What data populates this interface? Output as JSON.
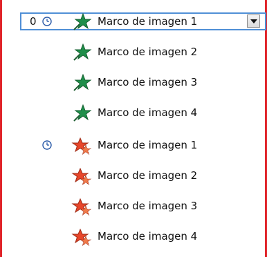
{
  "animation_pane": {
    "items": [
      {
        "order": "0",
        "has_clock": true,
        "effect": "entrance",
        "icon": "green-star-icon",
        "label": "Marco de imagen 1",
        "selected": true
      },
      {
        "order": "",
        "has_clock": false,
        "effect": "entrance",
        "icon": "green-star-icon",
        "label": "Marco de imagen 2",
        "selected": false
      },
      {
        "order": "",
        "has_clock": false,
        "effect": "entrance",
        "icon": "green-star-icon",
        "label": "Marco de imagen 3",
        "selected": false
      },
      {
        "order": "",
        "has_clock": false,
        "effect": "entrance",
        "icon": "green-star-icon",
        "label": "Marco de imagen 4",
        "selected": false
      },
      {
        "order": "",
        "has_clock": true,
        "effect": "exit",
        "icon": "red-star-icon",
        "label": "Marco de imagen 1",
        "selected": false
      },
      {
        "order": "",
        "has_clock": false,
        "effect": "exit",
        "icon": "red-star-icon",
        "label": "Marco de imagen 2",
        "selected": false
      },
      {
        "order": "",
        "has_clock": false,
        "effect": "exit",
        "icon": "red-star-icon",
        "label": "Marco de imagen 3",
        "selected": false
      },
      {
        "order": "",
        "has_clock": false,
        "effect": "exit",
        "icon": "red-star-icon",
        "label": "Marco de imagen 4",
        "selected": false
      }
    ],
    "colors": {
      "frame_border": "#e0242a",
      "selection_border": "#4f8fd6",
      "entrance_star": "#1f8f4a",
      "exit_star": "#e8462a"
    }
  }
}
